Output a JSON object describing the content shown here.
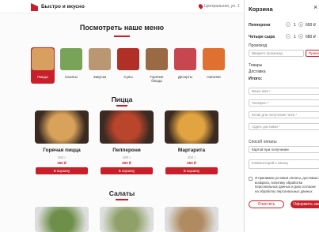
{
  "header": {
    "brand": "Быстро и вкусно",
    "address": "Центральная, ул. 1"
  },
  "menu": {
    "title": "Посмотреть наше меню"
  },
  "categories": [
    {
      "label": "Пицца",
      "active": true,
      "color": "#d8a060"
    },
    {
      "label": "Салаты",
      "active": false,
      "color": "#7aa35a"
    },
    {
      "label": "Закуски",
      "active": false,
      "color": "#b99772"
    },
    {
      "label": "Супы",
      "active": false,
      "color": "#b03028"
    },
    {
      "label": "Горячие блюда",
      "active": false,
      "color": "#9a6a44"
    },
    {
      "label": "Десерты",
      "active": false,
      "color": "#c8464f"
    },
    {
      "label": "Напитки",
      "active": false,
      "color": "#e07030"
    }
  ],
  "sections": {
    "pizza": "Пицца",
    "salads": "Салаты"
  },
  "products": [
    {
      "name": "Горячая пицца",
      "weight": "450 г",
      "price": "350 ₽",
      "button": "В корзину",
      "color": "#d9a25a"
    },
    {
      "name": "Пепперони",
      "weight": "480 г",
      "price": "600 ₽",
      "button": "В корзину",
      "color": "#b8452c"
    },
    {
      "name": "Маргарита",
      "weight": "450 г",
      "price": "550 ₽",
      "button": "В корзину",
      "color": "#e2a440"
    }
  ],
  "salads": [
    {
      "color": "#6d8f4a"
    },
    {
      "color": "#8fa068"
    },
    {
      "color": "#b08a60"
    }
  ],
  "cart": {
    "title": "Корзина",
    "close": "×",
    "items": [
      {
        "name": "Пепперони",
        "qty": "1",
        "price": "600 ₽"
      },
      {
        "name": "Четыре сыра",
        "qty": "1",
        "price": "680 ₽"
      }
    ],
    "promo_label": "Промокод",
    "promo_placeholder": "Введите промокод",
    "promo_button": "Приме",
    "goods_label": "Товары",
    "delivery_label": "Доставка",
    "total_label": "Итого:",
    "name_placeholder": "Ваше имя *",
    "phone_placeholder": "Телефон *",
    "email_placeholder": "Email для получения чека *",
    "address_placeholder": "Адрес доставки *",
    "payment_label": "Способ оплаты",
    "payment_value": "Картой при получении",
    "comment_placeholder": "Комментарий к заказу",
    "agreement": "Я принимаю условия оплаты, доставки и возврата, политику обработки персональных данных и даю согласие на обработку персональных данных",
    "clear_button": "Очистить",
    "order_button": "Оформить заказ"
  }
}
